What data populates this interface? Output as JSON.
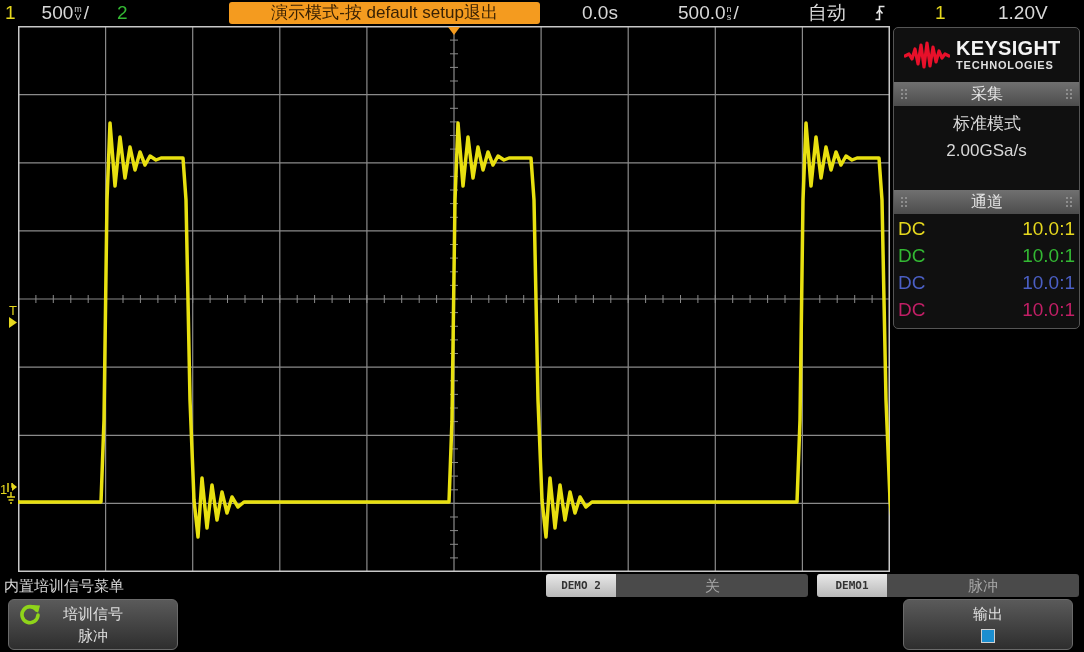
{
  "status_bar": {
    "channels": [
      {
        "number": "1",
        "color": "#e6d81e",
        "scale": {
          "value": "500",
          "unit": "mV",
          "suffix": "/"
        }
      },
      {
        "number": "2",
        "color": "#33b833"
      }
    ],
    "banner": "演示模式-按 default setup退出",
    "delay": "0.0s",
    "timebase": {
      "value": "500.0",
      "unit": "ns",
      "suffix": "/"
    },
    "trigger_mode": "自动",
    "trigger_source": "1",
    "trigger_level": "1.20V"
  },
  "display": {
    "markers": [
      {
        "kind": "trigger",
        "label": "T"
      },
      {
        "kind": "ground",
        "label": "1"
      }
    ]
  },
  "side_panel": {
    "logo": {
      "name": "KEYSIGHT",
      "tagline": "TECHNOLOGIES"
    },
    "sections": [
      {
        "title": "采集",
        "kind": "info",
        "lines": [
          "标准模式",
          "2.00GSa/s"
        ]
      },
      {
        "title": "通道",
        "kind": "channels",
        "rows": [
          {
            "coupling": "DC",
            "probe": "10.0:1",
            "color": "#e6d81e"
          },
          {
            "coupling": "DC",
            "probe": "10.0:1",
            "color": "#33b833"
          },
          {
            "coupling": "DC",
            "probe": "10.0:1",
            "color": "#4b5fc4"
          },
          {
            "coupling": "DC",
            "probe": "10.0:1",
            "color": "#c21f66"
          }
        ]
      }
    ]
  },
  "menu": {
    "title": "内置培训信号菜单",
    "outputs": [
      {
        "label": "DEMO 2",
        "value": "关"
      },
      {
        "label": "DEMO1",
        "value": "脉冲"
      }
    ],
    "softkeys": [
      {
        "kind": "cycle",
        "label": "培训信号",
        "value": "脉冲"
      },
      {
        "kind": "checkbox",
        "label": "输出",
        "checked": true
      }
    ]
  }
}
